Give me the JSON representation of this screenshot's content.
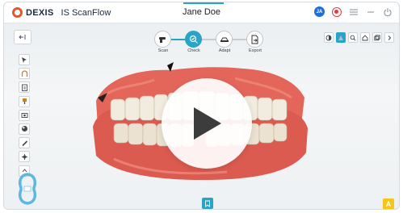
{
  "titlebar": {
    "brand": "DEXIS",
    "app_name": "IS ScanFlow",
    "patient_name": "Jane Doe",
    "user_initials": "JA",
    "icons": [
      "user-avatar",
      "record-icon",
      "menu-icon",
      "minimize-icon",
      "power-icon"
    ]
  },
  "workflow": {
    "steps": [
      {
        "label": "Scan",
        "icon": "scanner-icon",
        "active": false
      },
      {
        "label": "Check",
        "icon": "check-icon",
        "active": true
      },
      {
        "label": "Adapt",
        "icon": "adapt-icon",
        "active": false
      },
      {
        "label": "Export",
        "icon": "export-icon",
        "active": false
      }
    ]
  },
  "right_toolbar": {
    "icons": [
      "contrast-icon",
      "color-mode-icon",
      "zoom-icon",
      "view-icon",
      "snapshot-icon",
      "chevron-right-icon"
    ],
    "active_index": 1
  },
  "left_toolbar": {
    "icons": [
      "select-icon",
      "arch-icon",
      "clipboard-icon",
      "brush-icon",
      "camera-icon",
      "shading-icon",
      "measure-icon",
      "move-icon",
      "more-icon"
    ]
  },
  "badge": "A",
  "colors": {
    "accent": "#26a4c9",
    "record": "#e23b3b",
    "badge": "#f5c518"
  }
}
